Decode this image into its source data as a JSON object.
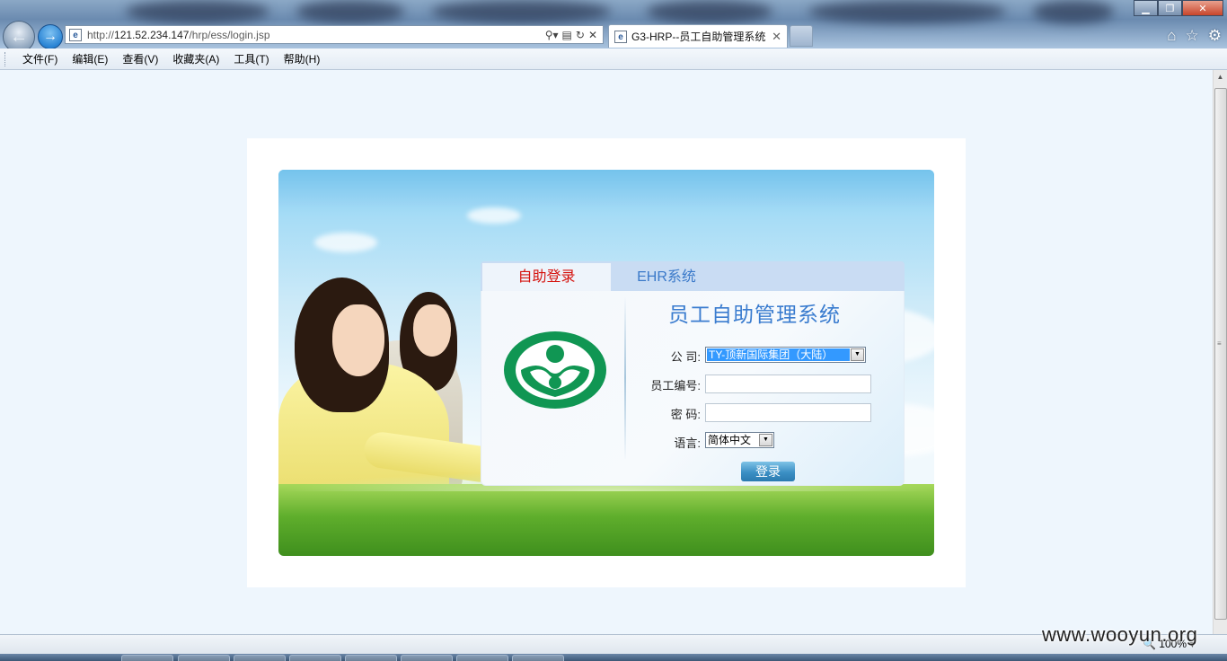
{
  "browser": {
    "address_url_prefix": "http://",
    "address_url_host": "121.52.234.147",
    "address_url_path": "/hrp/ess/login.jsp",
    "tab_title": "G3-HRP--员工自助管理系统",
    "zoom_level": "100%",
    "menu": [
      "文件(F)",
      "编辑(E)",
      "查看(V)",
      "收藏夹(A)",
      "工具(T)",
      "帮助(H)"
    ],
    "favicon_letter": "e"
  },
  "login": {
    "tabs": [
      "自助登录",
      "EHR系统"
    ],
    "active_tab": 0,
    "system_title": "员工自助管理系统",
    "company_label": "公 司:",
    "company_value": "TY-顶新国际集团（大陆）",
    "employee_id_label": "员工编号:",
    "employee_id_value": "",
    "password_label": "密 码:",
    "password_value": "",
    "language_label": "语言:",
    "language_value": "简体中文",
    "login_button": "登录"
  },
  "watermark": "www.wooyun.org",
  "colors": {
    "active_tab_text": "#d5130e",
    "inactive_tab_text": "#3a79c9",
    "title_text": "#3a7ccf",
    "logo_green": "#109653",
    "select_highlight": "#3399ff"
  },
  "icons": [
    "back-arrow-icon",
    "forward-arrow-icon",
    "search-icon",
    "refresh-icon",
    "stop-icon",
    "home-icon",
    "favorites-star-icon",
    "tools-gear-icon",
    "company-logo-icon"
  ]
}
